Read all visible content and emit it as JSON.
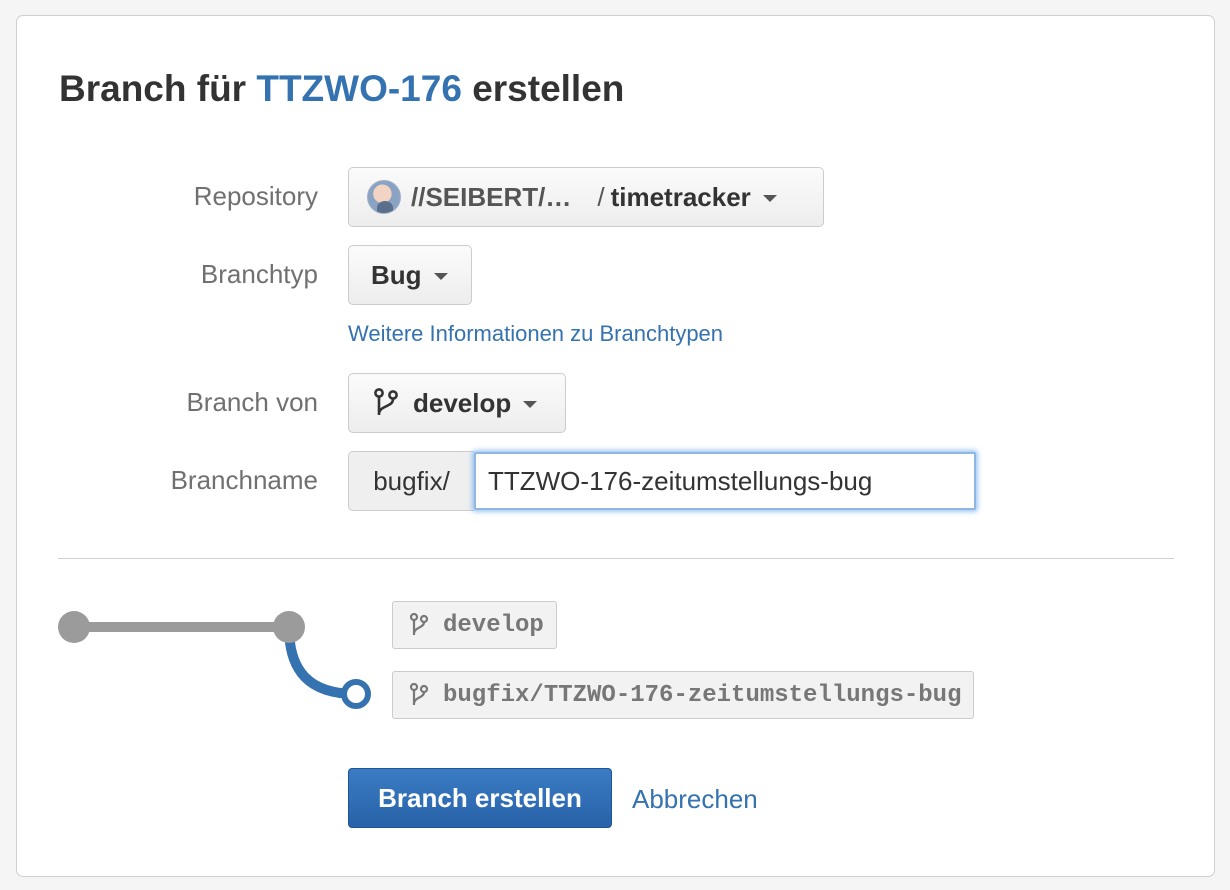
{
  "dialog": {
    "title_prefix": "Branch für ",
    "issue_key": "TTZWO-176",
    "title_suffix": " erstellen"
  },
  "form": {
    "repository_label": "Repository",
    "repository_owner": "//SEIBERT/…",
    "repository_sep": "/",
    "repository_name": "timetracker",
    "branchtype_label": "Branchtyp",
    "branchtype_value": "Bug",
    "branchtype_help_link": "Weitere Informationen zu Branchtypen",
    "branch_from_label": "Branch von",
    "branch_from_value": "develop",
    "branchname_label": "Branchname",
    "branchname_prefix": "bugfix/",
    "branchname_value": "TTZWO-176-zeitumstellungs-bug"
  },
  "preview": {
    "source_branch": "develop",
    "new_branch": "bugfix/TTZWO-176-zeitumstellungs-bug"
  },
  "actions": {
    "submit_label": "Branch erstellen",
    "cancel_label": "Abbrechen"
  },
  "colors": {
    "accent": "#3572b0",
    "line_gray": "#9b9b9b",
    "focus_border": "#8fb7e6"
  },
  "icons": [
    "avatar",
    "caret-down-icon",
    "branch-icon"
  ]
}
